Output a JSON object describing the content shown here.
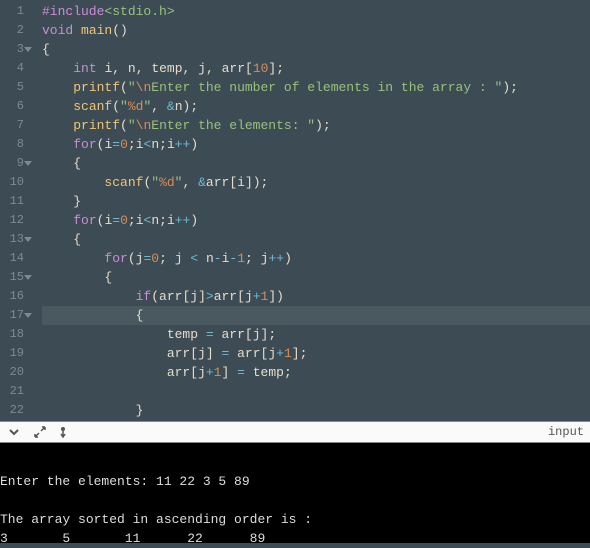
{
  "editor": {
    "current_line": 17,
    "lines": [
      {
        "n": 1,
        "fold": false,
        "html": "<span class='tok-preproc'>#include</span><span class='tok-incfile'>&lt;stdio.h&gt;</span>"
      },
      {
        "n": 2,
        "fold": false,
        "html": "<span class='tok-type'>void</span> <span class='tok-fn'>main</span><span class='tok-punc'>()</span>"
      },
      {
        "n": 3,
        "fold": true,
        "html": "<span class='tok-punc'>{</span>"
      },
      {
        "n": 4,
        "fold": false,
        "html": "    <span class='tok-type'>int</span> <span class='tok-ident'>i</span><span class='tok-punc'>,</span> <span class='tok-ident'>n</span><span class='tok-punc'>,</span> <span class='tok-ident'>temp</span><span class='tok-punc'>,</span> <span class='tok-ident'>j</span><span class='tok-punc'>,</span> <span class='tok-ident'>arr</span><span class='tok-punc'>[</span><span class='tok-num'>10</span><span class='tok-punc'>];</span>"
      },
      {
        "n": 5,
        "fold": false,
        "html": "    <span class='tok-fn'>printf</span><span class='tok-punc'>(</span><span class='tok-str'>\"</span><span class='tok-esc'>\\n</span><span class='tok-str'>Enter the number of elements in the array : \"</span><span class='tok-punc'>);</span>"
      },
      {
        "n": 6,
        "fold": false,
        "html": "    <span class='tok-fn'>scanf</span><span class='tok-punc'>(</span><span class='tok-str'>\"</span><span class='tok-esc'>%d</span><span class='tok-str'>\"</span><span class='tok-punc'>,</span> <span class='tok-op'>&amp;</span><span class='tok-ident'>n</span><span class='tok-punc'>);</span>"
      },
      {
        "n": 7,
        "fold": false,
        "html": "    <span class='tok-fn'>printf</span><span class='tok-punc'>(</span><span class='tok-str'>\"</span><span class='tok-esc'>\\n</span><span class='tok-str'>Enter the elements: \"</span><span class='tok-punc'>);</span>"
      },
      {
        "n": 8,
        "fold": false,
        "html": "    <span class='tok-keyword'>for</span><span class='tok-punc'>(</span><span class='tok-ident'>i</span><span class='tok-op'>=</span><span class='tok-num'>0</span><span class='tok-punc'>;</span><span class='tok-ident'>i</span><span class='tok-op'>&lt;</span><span class='tok-ident'>n</span><span class='tok-punc'>;</span><span class='tok-ident'>i</span><span class='tok-op'>++</span><span class='tok-punc'>)</span>"
      },
      {
        "n": 9,
        "fold": true,
        "html": "    <span class='tok-punc'>{</span>"
      },
      {
        "n": 10,
        "fold": false,
        "html": "        <span class='tok-fn'>scanf</span><span class='tok-punc'>(</span><span class='tok-str'>\"</span><span class='tok-esc'>%d</span><span class='tok-str'>\"</span><span class='tok-punc'>,</span> <span class='tok-op'>&amp;</span><span class='tok-ident'>arr</span><span class='tok-punc'>[</span><span class='tok-ident'>i</span><span class='tok-punc'>]);</span>"
      },
      {
        "n": 11,
        "fold": false,
        "html": "    <span class='tok-punc'>}</span>"
      },
      {
        "n": 12,
        "fold": false,
        "html": "    <span class='tok-keyword'>for</span><span class='tok-punc'>(</span><span class='tok-ident'>i</span><span class='tok-op'>=</span><span class='tok-num'>0</span><span class='tok-punc'>;</span><span class='tok-ident'>i</span><span class='tok-op'>&lt;</span><span class='tok-ident'>n</span><span class='tok-punc'>;</span><span class='tok-ident'>i</span><span class='tok-op'>++</span><span class='tok-punc'>)</span>"
      },
      {
        "n": 13,
        "fold": true,
        "html": "    <span class='tok-punc'>{</span>"
      },
      {
        "n": 14,
        "fold": false,
        "html": "        <span class='tok-keyword'>for</span><span class='tok-punc'>(</span><span class='tok-ident'>j</span><span class='tok-op'>=</span><span class='tok-num'>0</span><span class='tok-punc'>;</span> <span class='tok-ident'>j</span> <span class='tok-op'>&lt;</span> <span class='tok-ident'>n</span><span class='tok-op'>-</span><span class='tok-ident'>i</span><span class='tok-op'>-</span><span class='tok-num'>1</span><span class='tok-punc'>;</span> <span class='tok-ident'>j</span><span class='tok-op'>++</span><span class='tok-punc'>)</span>"
      },
      {
        "n": 15,
        "fold": true,
        "html": "        <span class='tok-punc'>{</span>"
      },
      {
        "n": 16,
        "fold": false,
        "html": "            <span class='tok-keyword'>if</span><span class='tok-punc'>(</span><span class='tok-ident'>arr</span><span class='tok-punc'>[</span><span class='tok-ident'>j</span><span class='tok-punc'>]</span><span class='tok-op'>&gt;</span><span class='tok-ident'>arr</span><span class='tok-punc'>[</span><span class='tok-ident'>j</span><span class='tok-op'>+</span><span class='tok-num'>1</span><span class='tok-punc'>])</span>"
      },
      {
        "n": 17,
        "fold": true,
        "html": "            <span class='tok-punc'>{</span>"
      },
      {
        "n": 18,
        "fold": false,
        "html": "                <span class='tok-ident'>temp</span> <span class='tok-op'>=</span> <span class='tok-ident'>arr</span><span class='tok-punc'>[</span><span class='tok-ident'>j</span><span class='tok-punc'>];</span>"
      },
      {
        "n": 19,
        "fold": false,
        "html": "                <span class='tok-ident'>arr</span><span class='tok-punc'>[</span><span class='tok-ident'>j</span><span class='tok-punc'>]</span> <span class='tok-op'>=</span> <span class='tok-ident'>arr</span><span class='tok-punc'>[</span><span class='tok-ident'>j</span><span class='tok-op'>+</span><span class='tok-num'>1</span><span class='tok-punc'>];</span>"
      },
      {
        "n": 20,
        "fold": false,
        "html": "                <span class='tok-ident'>arr</span><span class='tok-punc'>[</span><span class='tok-ident'>j</span><span class='tok-op'>+</span><span class='tok-num'>1</span><span class='tok-punc'>]</span> <span class='tok-op'>=</span> <span class='tok-ident'>temp</span><span class='tok-punc'>;</span>"
      },
      {
        "n": 21,
        "fold": false,
        "html": ""
      },
      {
        "n": 22,
        "fold": false,
        "html": "            <span class='tok-punc'>}</span>"
      }
    ]
  },
  "toolbar": {
    "right_label": "input"
  },
  "terminal": {
    "content": "\nEnter the elements: 11 22 3 5 89\n\nThe array sorted in ascending order is :\n3       5       11      22      89"
  }
}
